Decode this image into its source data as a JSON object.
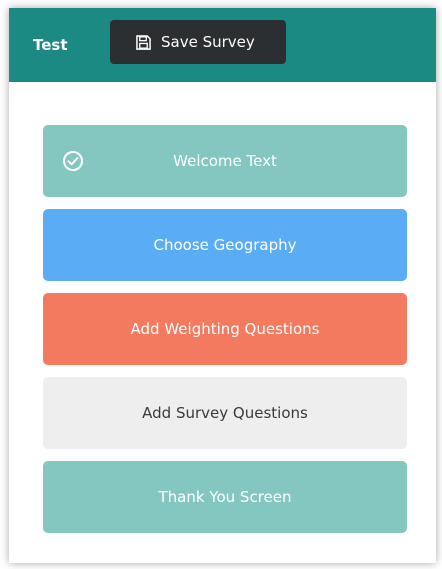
{
  "header": {
    "app_title": "Test",
    "save_label": "Save Survey",
    "save_icon": "floppy-disk-icon",
    "bar_color": "#1a8a82",
    "button_color": "#2b2f31"
  },
  "steps": [
    {
      "label": "Welcome Text",
      "color": "#84c7c1",
      "text_color": "#ffffff",
      "completed": true,
      "icon": "check-circle-icon"
    },
    {
      "label": "Choose Geography",
      "color": "#5aacf5",
      "text_color": "#ffffff",
      "completed": false
    },
    {
      "label": "Add Weighting Questions",
      "color": "#f37a5f",
      "text_color": "#ffffff",
      "completed": false
    },
    {
      "label": "Add Survey Questions",
      "color": "#eeeeee",
      "text_color": "#3a3a3a",
      "completed": false
    },
    {
      "label": "Thank You Screen",
      "color": "#84c7c1",
      "text_color": "#ffffff",
      "completed": false
    }
  ]
}
